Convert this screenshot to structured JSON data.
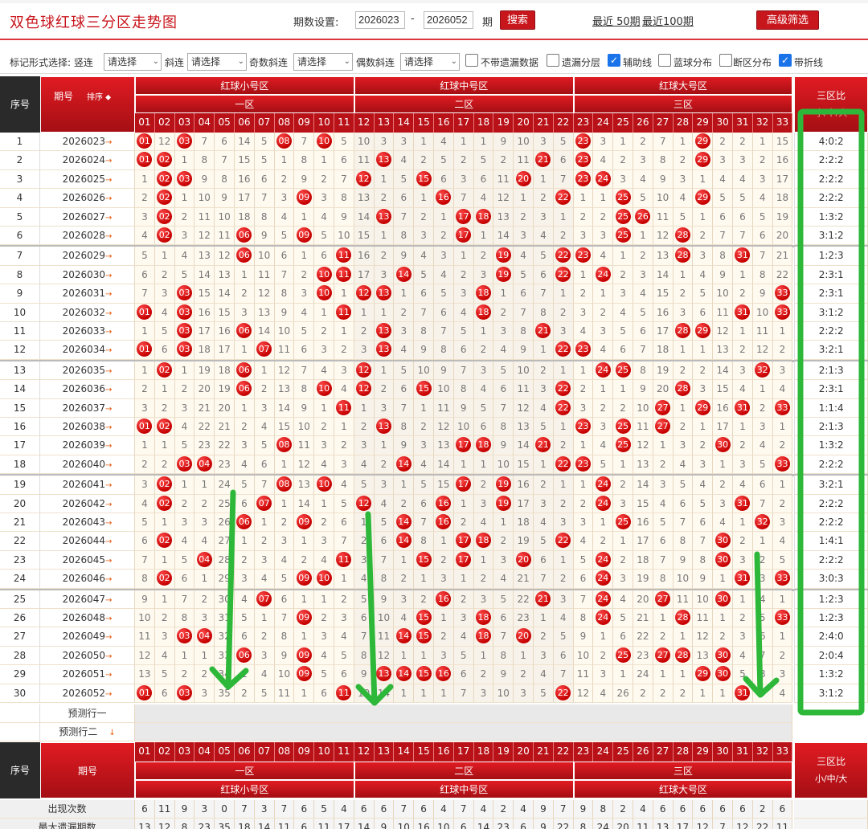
{
  "page": {
    "title": "双色球红球三分区走势图",
    "period_label": "期数设置:",
    "period_from": "2026023",
    "period_to": "2026052",
    "period_suffix": "期",
    "dash": "-",
    "search_label": "搜索",
    "recent50": "最近 50期",
    "recent100": "最近100期",
    "advanced_label": "高级筛选"
  },
  "toolbar": {
    "mark_label": "标记形式选择: 竖连",
    "select_placeholder": "请选择",
    "slant_label": "斜连",
    "odd_label": "奇数斜连",
    "even_label": "偶数斜连",
    "opt1": "不带遗漏数据",
    "opt2": "遗漏分层",
    "opt3": "辅助线",
    "opt4": "蓝球分布",
    "opt5": "断区分布",
    "opt6": "带折线",
    "checked": [
      false,
      false,
      true,
      false,
      false,
      true
    ]
  },
  "header": {
    "seq": "序号",
    "period": "期号",
    "sort": "排序",
    "zone1_top": "红球小号区",
    "zone2_top": "红球中号区",
    "zone3_top": "红球大号区",
    "zone1": "一区",
    "zone2": "二区",
    "zone3": "三区",
    "ratio_title": "三区比",
    "ratio_sub": "小/中/大",
    "numbers": [
      "01",
      "02",
      "03",
      "04",
      "05",
      "06",
      "07",
      "08",
      "09",
      "10",
      "11",
      "12",
      "13",
      "14",
      "15",
      "16",
      "17",
      "18",
      "19",
      "20",
      "21",
      "22",
      "23",
      "24",
      "25",
      "26",
      "27",
      "28",
      "29",
      "30",
      "31",
      "32",
      "33"
    ]
  },
  "rows": [
    {
      "seq": "1",
      "period": "2026023",
      "cells": [
        "01",
        "12",
        "03",
        "7",
        "6",
        "14",
        "5",
        "08",
        "7",
        "10",
        "5",
        "10",
        "3",
        "3",
        "1",
        "4",
        "1",
        "1",
        "9",
        "10",
        "3",
        "5",
        "23",
        "3",
        "1",
        "2",
        "7",
        "1",
        "29",
        "2",
        "2",
        "1",
        "15"
      ],
      "ratio": "4:0:2"
    },
    {
      "seq": "2",
      "period": "2026024",
      "cells": [
        "01",
        "02",
        "1",
        "8",
        "7",
        "15",
        "5",
        "1",
        "8",
        "1",
        "6",
        "11",
        "13",
        "4",
        "2",
        "5",
        "2",
        "5",
        "2",
        "11",
        "21",
        "6",
        "23",
        "4",
        "2",
        "3",
        "8",
        "2",
        "29",
        "3",
        "3",
        "2",
        "16"
      ],
      "ratio": "2:2:2"
    },
    {
      "seq": "3",
      "period": "2026025",
      "cells": [
        "1",
        "02",
        "03",
        "9",
        "8",
        "16",
        "6",
        "2",
        "9",
        "2",
        "7",
        "12",
        "1",
        "5",
        "15",
        "6",
        "3",
        "6",
        "11",
        "20",
        "1",
        "7",
        "23",
        "24",
        "3",
        "4",
        "9",
        "3",
        "1",
        "4",
        "4",
        "3",
        "17"
      ],
      "ratio": "2:2:2"
    },
    {
      "seq": "4",
      "period": "2026026",
      "cells": [
        "2",
        "02",
        "1",
        "10",
        "9",
        "17",
        "7",
        "3",
        "09",
        "3",
        "8",
        "13",
        "2",
        "6",
        "1",
        "16",
        "7",
        "4",
        "12",
        "1",
        "2",
        "22",
        "1",
        "1",
        "25",
        "5",
        "10",
        "4",
        "29",
        "5",
        "5",
        "4",
        "18"
      ],
      "ratio": "2:2:2"
    },
    {
      "seq": "5",
      "period": "2026027",
      "cells": [
        "3",
        "02",
        "2",
        "11",
        "10",
        "18",
        "8",
        "4",
        "1",
        "4",
        "9",
        "14",
        "13",
        "7",
        "2",
        "1",
        "17",
        "18",
        "13",
        "2",
        "3",
        "1",
        "2",
        "2",
        "25",
        "26",
        "11",
        "5",
        "1",
        "6",
        "6",
        "5",
        "19"
      ],
      "ratio": "1:3:2"
    },
    {
      "seq": "6",
      "period": "2026028",
      "cells": [
        "4",
        "02",
        "3",
        "12",
        "11",
        "06",
        "9",
        "5",
        "09",
        "5",
        "10",
        "15",
        "1",
        "8",
        "3",
        "2",
        "17",
        "1",
        "14",
        "3",
        "4",
        "2",
        "3",
        "3",
        "25",
        "1",
        "12",
        "28",
        "2",
        "7",
        "7",
        "6",
        "20"
      ],
      "ratio": "3:1:2"
    },
    {
      "seq": "7",
      "period": "2026029",
      "cells": [
        "5",
        "1",
        "4",
        "13",
        "12",
        "06",
        "10",
        "6",
        "1",
        "6",
        "11",
        "16",
        "2",
        "9",
        "4",
        "3",
        "1",
        "2",
        "19",
        "4",
        "5",
        "22",
        "23",
        "4",
        "1",
        "2",
        "13",
        "28",
        "3",
        "8",
        "31",
        "7",
        "21"
      ],
      "ratio": "1:2:3"
    },
    {
      "seq": "8",
      "period": "2026030",
      "cells": [
        "6",
        "2",
        "5",
        "14",
        "13",
        "1",
        "11",
        "7",
        "2",
        "10",
        "11",
        "17",
        "3",
        "14",
        "5",
        "4",
        "2",
        "3",
        "19",
        "5",
        "6",
        "22",
        "1",
        "24",
        "2",
        "3",
        "14",
        "1",
        "4",
        "9",
        "1",
        "8",
        "22"
      ],
      "ratio": "2:3:1"
    },
    {
      "seq": "9",
      "period": "2026031",
      "cells": [
        "7",
        "3",
        "03",
        "15",
        "14",
        "2",
        "12",
        "8",
        "3",
        "10",
        "1",
        "12",
        "13",
        "1",
        "6",
        "5",
        "3",
        "18",
        "1",
        "6",
        "7",
        "1",
        "2",
        "1",
        "3",
        "4",
        "15",
        "2",
        "5",
        "10",
        "2",
        "9",
        "33"
      ],
      "ratio": "2:3:1"
    },
    {
      "seq": "10",
      "period": "2026032",
      "cells": [
        "01",
        "4",
        "03",
        "16",
        "15",
        "3",
        "13",
        "9",
        "4",
        "1",
        "11",
        "1",
        "1",
        "2",
        "7",
        "6",
        "4",
        "18",
        "2",
        "7",
        "8",
        "2",
        "3",
        "2",
        "4",
        "5",
        "16",
        "3",
        "6",
        "11",
        "31",
        "10",
        "33"
      ],
      "ratio": "3:1:2"
    },
    {
      "seq": "11",
      "period": "2026033",
      "cells": [
        "1",
        "5",
        "03",
        "17",
        "16",
        "06",
        "14",
        "10",
        "5",
        "2",
        "1",
        "2",
        "13",
        "3",
        "8",
        "7",
        "5",
        "1",
        "3",
        "8",
        "21",
        "3",
        "4",
        "3",
        "5",
        "6",
        "17",
        "28",
        "29",
        "12",
        "1",
        "11",
        "1"
      ],
      "ratio": "2:2:2"
    },
    {
      "seq": "12",
      "period": "2026034",
      "cells": [
        "01",
        "6",
        "03",
        "18",
        "17",
        "1",
        "07",
        "11",
        "6",
        "3",
        "2",
        "3",
        "13",
        "4",
        "9",
        "8",
        "6",
        "2",
        "4",
        "9",
        "1",
        "22",
        "23",
        "4",
        "6",
        "7",
        "18",
        "1",
        "1",
        "13",
        "2",
        "12",
        "2"
      ],
      "ratio": "3:2:1"
    },
    {
      "seq": "13",
      "period": "2026035",
      "cells": [
        "1",
        "02",
        "1",
        "19",
        "18",
        "06",
        "1",
        "12",
        "7",
        "4",
        "3",
        "12",
        "1",
        "5",
        "10",
        "9",
        "7",
        "3",
        "5",
        "10",
        "2",
        "1",
        "1",
        "24",
        "25",
        "8",
        "19",
        "2",
        "2",
        "14",
        "3",
        "32",
        "3"
      ],
      "ratio": "2:1:3"
    },
    {
      "seq": "14",
      "period": "2026036",
      "cells": [
        "2",
        "1",
        "2",
        "20",
        "19",
        "06",
        "2",
        "13",
        "8",
        "10",
        "4",
        "12",
        "2",
        "6",
        "15",
        "10",
        "8",
        "4",
        "6",
        "11",
        "3",
        "22",
        "2",
        "1",
        "1",
        "9",
        "20",
        "28",
        "3",
        "15",
        "4",
        "1",
        "4"
      ],
      "ratio": "2:3:1"
    },
    {
      "seq": "15",
      "period": "2026037",
      "cells": [
        "3",
        "2",
        "3",
        "21",
        "20",
        "1",
        "3",
        "14",
        "9",
        "1",
        "11",
        "1",
        "3",
        "7",
        "1",
        "11",
        "9",
        "5",
        "7",
        "12",
        "4",
        "22",
        "3",
        "2",
        "2",
        "10",
        "27",
        "1",
        "29",
        "16",
        "31",
        "2",
        "33"
      ],
      "ratio": "1:1:4"
    },
    {
      "seq": "16",
      "period": "2026038",
      "cells": [
        "01",
        "02",
        "4",
        "22",
        "21",
        "2",
        "4",
        "15",
        "10",
        "2",
        "1",
        "2",
        "13",
        "8",
        "2",
        "12",
        "10",
        "6",
        "8",
        "13",
        "5",
        "1",
        "23",
        "3",
        "25",
        "11",
        "27",
        "2",
        "1",
        "17",
        "1",
        "3",
        "1"
      ],
      "ratio": "2:1:3"
    },
    {
      "seq": "17",
      "period": "2026039",
      "cells": [
        "1",
        "1",
        "5",
        "23",
        "22",
        "3",
        "5",
        "08",
        "11",
        "3",
        "2",
        "3",
        "1",
        "9",
        "3",
        "13",
        "17",
        "18",
        "9",
        "14",
        "21",
        "2",
        "1",
        "4",
        "25",
        "12",
        "1",
        "3",
        "2",
        "30",
        "2",
        "4",
        "2"
      ],
      "ratio": "1:3:2"
    },
    {
      "seq": "18",
      "period": "2026040",
      "cells": [
        "2",
        "2",
        "03",
        "04",
        "23",
        "4",
        "6",
        "1",
        "12",
        "4",
        "3",
        "4",
        "2",
        "14",
        "4",
        "14",
        "1",
        "1",
        "10",
        "15",
        "1",
        "22",
        "23",
        "5",
        "1",
        "13",
        "2",
        "4",
        "3",
        "1",
        "3",
        "5",
        "33"
      ],
      "ratio": "2:2:2"
    },
    {
      "seq": "19",
      "period": "2026041",
      "cells": [
        "3",
        "02",
        "1",
        "1",
        "24",
        "5",
        "7",
        "08",
        "13",
        "10",
        "4",
        "5",
        "3",
        "1",
        "5",
        "15",
        "17",
        "2",
        "19",
        "16",
        "2",
        "1",
        "1",
        "24",
        "2",
        "14",
        "3",
        "5",
        "4",
        "2",
        "4",
        "6",
        "1"
      ],
      "ratio": "3:2:1"
    },
    {
      "seq": "20",
      "period": "2026042",
      "cells": [
        "4",
        "02",
        "2",
        "2",
        "25",
        "6",
        "07",
        "1",
        "14",
        "1",
        "5",
        "12",
        "4",
        "2",
        "6",
        "16",
        "1",
        "3",
        "19",
        "17",
        "3",
        "2",
        "2",
        "24",
        "3",
        "15",
        "4",
        "6",
        "5",
        "3",
        "31",
        "7",
        "2"
      ],
      "ratio": "2:2:2"
    },
    {
      "seq": "21",
      "period": "2026043",
      "cells": [
        "5",
        "1",
        "3",
        "3",
        "26",
        "06",
        "1",
        "2",
        "09",
        "2",
        "6",
        "1",
        "5",
        "14",
        "7",
        "16",
        "2",
        "4",
        "1",
        "18",
        "4",
        "3",
        "3",
        "1",
        "25",
        "16",
        "5",
        "7",
        "6",
        "4",
        "1",
        "32",
        "3"
      ],
      "ratio": "2:2:2"
    },
    {
      "seq": "22",
      "period": "2026044",
      "cells": [
        "6",
        "02",
        "4",
        "4",
        "27",
        "1",
        "2",
        "3",
        "1",
        "3",
        "7",
        "2",
        "6",
        "14",
        "8",
        "1",
        "17",
        "18",
        "2",
        "19",
        "5",
        "22",
        "4",
        "2",
        "1",
        "17",
        "6",
        "8",
        "7",
        "30",
        "2",
        "1",
        "4"
      ],
      "ratio": "1:4:1"
    },
    {
      "seq": "23",
      "period": "2026045",
      "cells": [
        "7",
        "1",
        "5",
        "04",
        "28",
        "2",
        "3",
        "4",
        "2",
        "4",
        "11",
        "3",
        "7",
        "1",
        "15",
        "2",
        "17",
        "1",
        "3",
        "20",
        "6",
        "1",
        "5",
        "24",
        "2",
        "18",
        "7",
        "9",
        "8",
        "30",
        "3",
        "2",
        "5"
      ],
      "ratio": "2:2:2"
    },
    {
      "seq": "24",
      "period": "2026046",
      "cells": [
        "8",
        "02",
        "6",
        "1",
        "29",
        "3",
        "4",
        "5",
        "09",
        "10",
        "1",
        "4",
        "8",
        "2",
        "1",
        "3",
        "1",
        "2",
        "4",
        "21",
        "7",
        "2",
        "6",
        "24",
        "3",
        "19",
        "8",
        "10",
        "9",
        "1",
        "31",
        "3",
        "33"
      ],
      "ratio": "3:0:3"
    },
    {
      "seq": "25",
      "period": "2026047",
      "cells": [
        "9",
        "1",
        "7",
        "2",
        "30",
        "4",
        "07",
        "6",
        "1",
        "1",
        "2",
        "5",
        "9",
        "3",
        "2",
        "16",
        "2",
        "3",
        "5",
        "22",
        "21",
        "3",
        "7",
        "24",
        "4",
        "20",
        "27",
        "11",
        "10",
        "30",
        "1",
        "4",
        "1"
      ],
      "ratio": "1:2:3"
    },
    {
      "seq": "26",
      "period": "2026048",
      "cells": [
        "10",
        "2",
        "8",
        "3",
        "31",
        "5",
        "1",
        "7",
        "09",
        "2",
        "3",
        "6",
        "10",
        "4",
        "15",
        "1",
        "3",
        "18",
        "6",
        "23",
        "1",
        "4",
        "8",
        "24",
        "5",
        "21",
        "1",
        "28",
        "11",
        "1",
        "2",
        "5",
        "33"
      ],
      "ratio": "1:2:3"
    },
    {
      "seq": "27",
      "period": "2026049",
      "cells": [
        "11",
        "3",
        "03",
        "04",
        "32",
        "6",
        "2",
        "8",
        "1",
        "3",
        "4",
        "7",
        "11",
        "14",
        "15",
        "2",
        "4",
        "18",
        "7",
        "20",
        "2",
        "5",
        "9",
        "1",
        "6",
        "22",
        "2",
        "1",
        "12",
        "2",
        "3",
        "6",
        "1"
      ],
      "ratio": "2:4:0"
    },
    {
      "seq": "28",
      "period": "2026050",
      "cells": [
        "12",
        "4",
        "1",
        "1",
        "33",
        "06",
        "3",
        "9",
        "09",
        "4",
        "5",
        "8",
        "12",
        "1",
        "1",
        "3",
        "5",
        "1",
        "8",
        "1",
        "3",
        "6",
        "10",
        "2",
        "25",
        "23",
        "27",
        "28",
        "13",
        "30",
        "4",
        "7",
        "2"
      ],
      "ratio": "2:0:4"
    },
    {
      "seq": "29",
      "period": "2026051",
      "cells": [
        "13",
        "5",
        "2",
        "2",
        "34",
        "1",
        "4",
        "10",
        "09",
        "5",
        "6",
        "9",
        "13",
        "14",
        "15",
        "16",
        "6",
        "2",
        "9",
        "2",
        "4",
        "7",
        "11",
        "3",
        "1",
        "24",
        "1",
        "1",
        "29",
        "30",
        "5",
        "8",
        "3"
      ],
      "ratio": "1:3:2"
    },
    {
      "seq": "30",
      "period": "2026052",
      "cells": [
        "01",
        "6",
        "03",
        "3",
        "35",
        "2",
        "5",
        "11",
        "1",
        "6",
        "11",
        "10",
        "14",
        "1",
        "1",
        "1",
        "7",
        "3",
        "10",
        "3",
        "5",
        "22",
        "12",
        "4",
        "26",
        "2",
        "2",
        "2",
        "1",
        "1",
        "31",
        "9",
        "4"
      ],
      "ratio": "3:1:2"
    }
  ],
  "predict": [
    "预测行一",
    "预测行二"
  ],
  "footer": {
    "seq": "序号",
    "period": "期号",
    "occur_label": "出现次数",
    "occur": [
      "6",
      "11",
      "9",
      "3",
      "0",
      "7",
      "3",
      "7",
      "6",
      "5",
      "4",
      "6",
      "6",
      "7",
      "6",
      "4",
      "7",
      "4",
      "2",
      "4",
      "9",
      "7",
      "9",
      "8",
      "2",
      "4",
      "6",
      "6",
      "6",
      "6",
      "6",
      "2",
      "6"
    ],
    "maxmiss_label": "最大遗漏期数",
    "maxmiss": [
      "13",
      "12",
      "8",
      "23",
      "35",
      "18",
      "14",
      "11",
      "6",
      "11",
      "17",
      "14",
      "9",
      "10",
      "16",
      "10",
      "6",
      "14",
      "23",
      "6",
      "9",
      "22",
      "8",
      "24",
      "20",
      "11",
      "13",
      "17",
      "12",
      "7",
      "12",
      "22",
      "11"
    ]
  },
  "colors": {
    "accent": "#c8161d",
    "ball": "#d40000",
    "guide": "#2db83a"
  }
}
